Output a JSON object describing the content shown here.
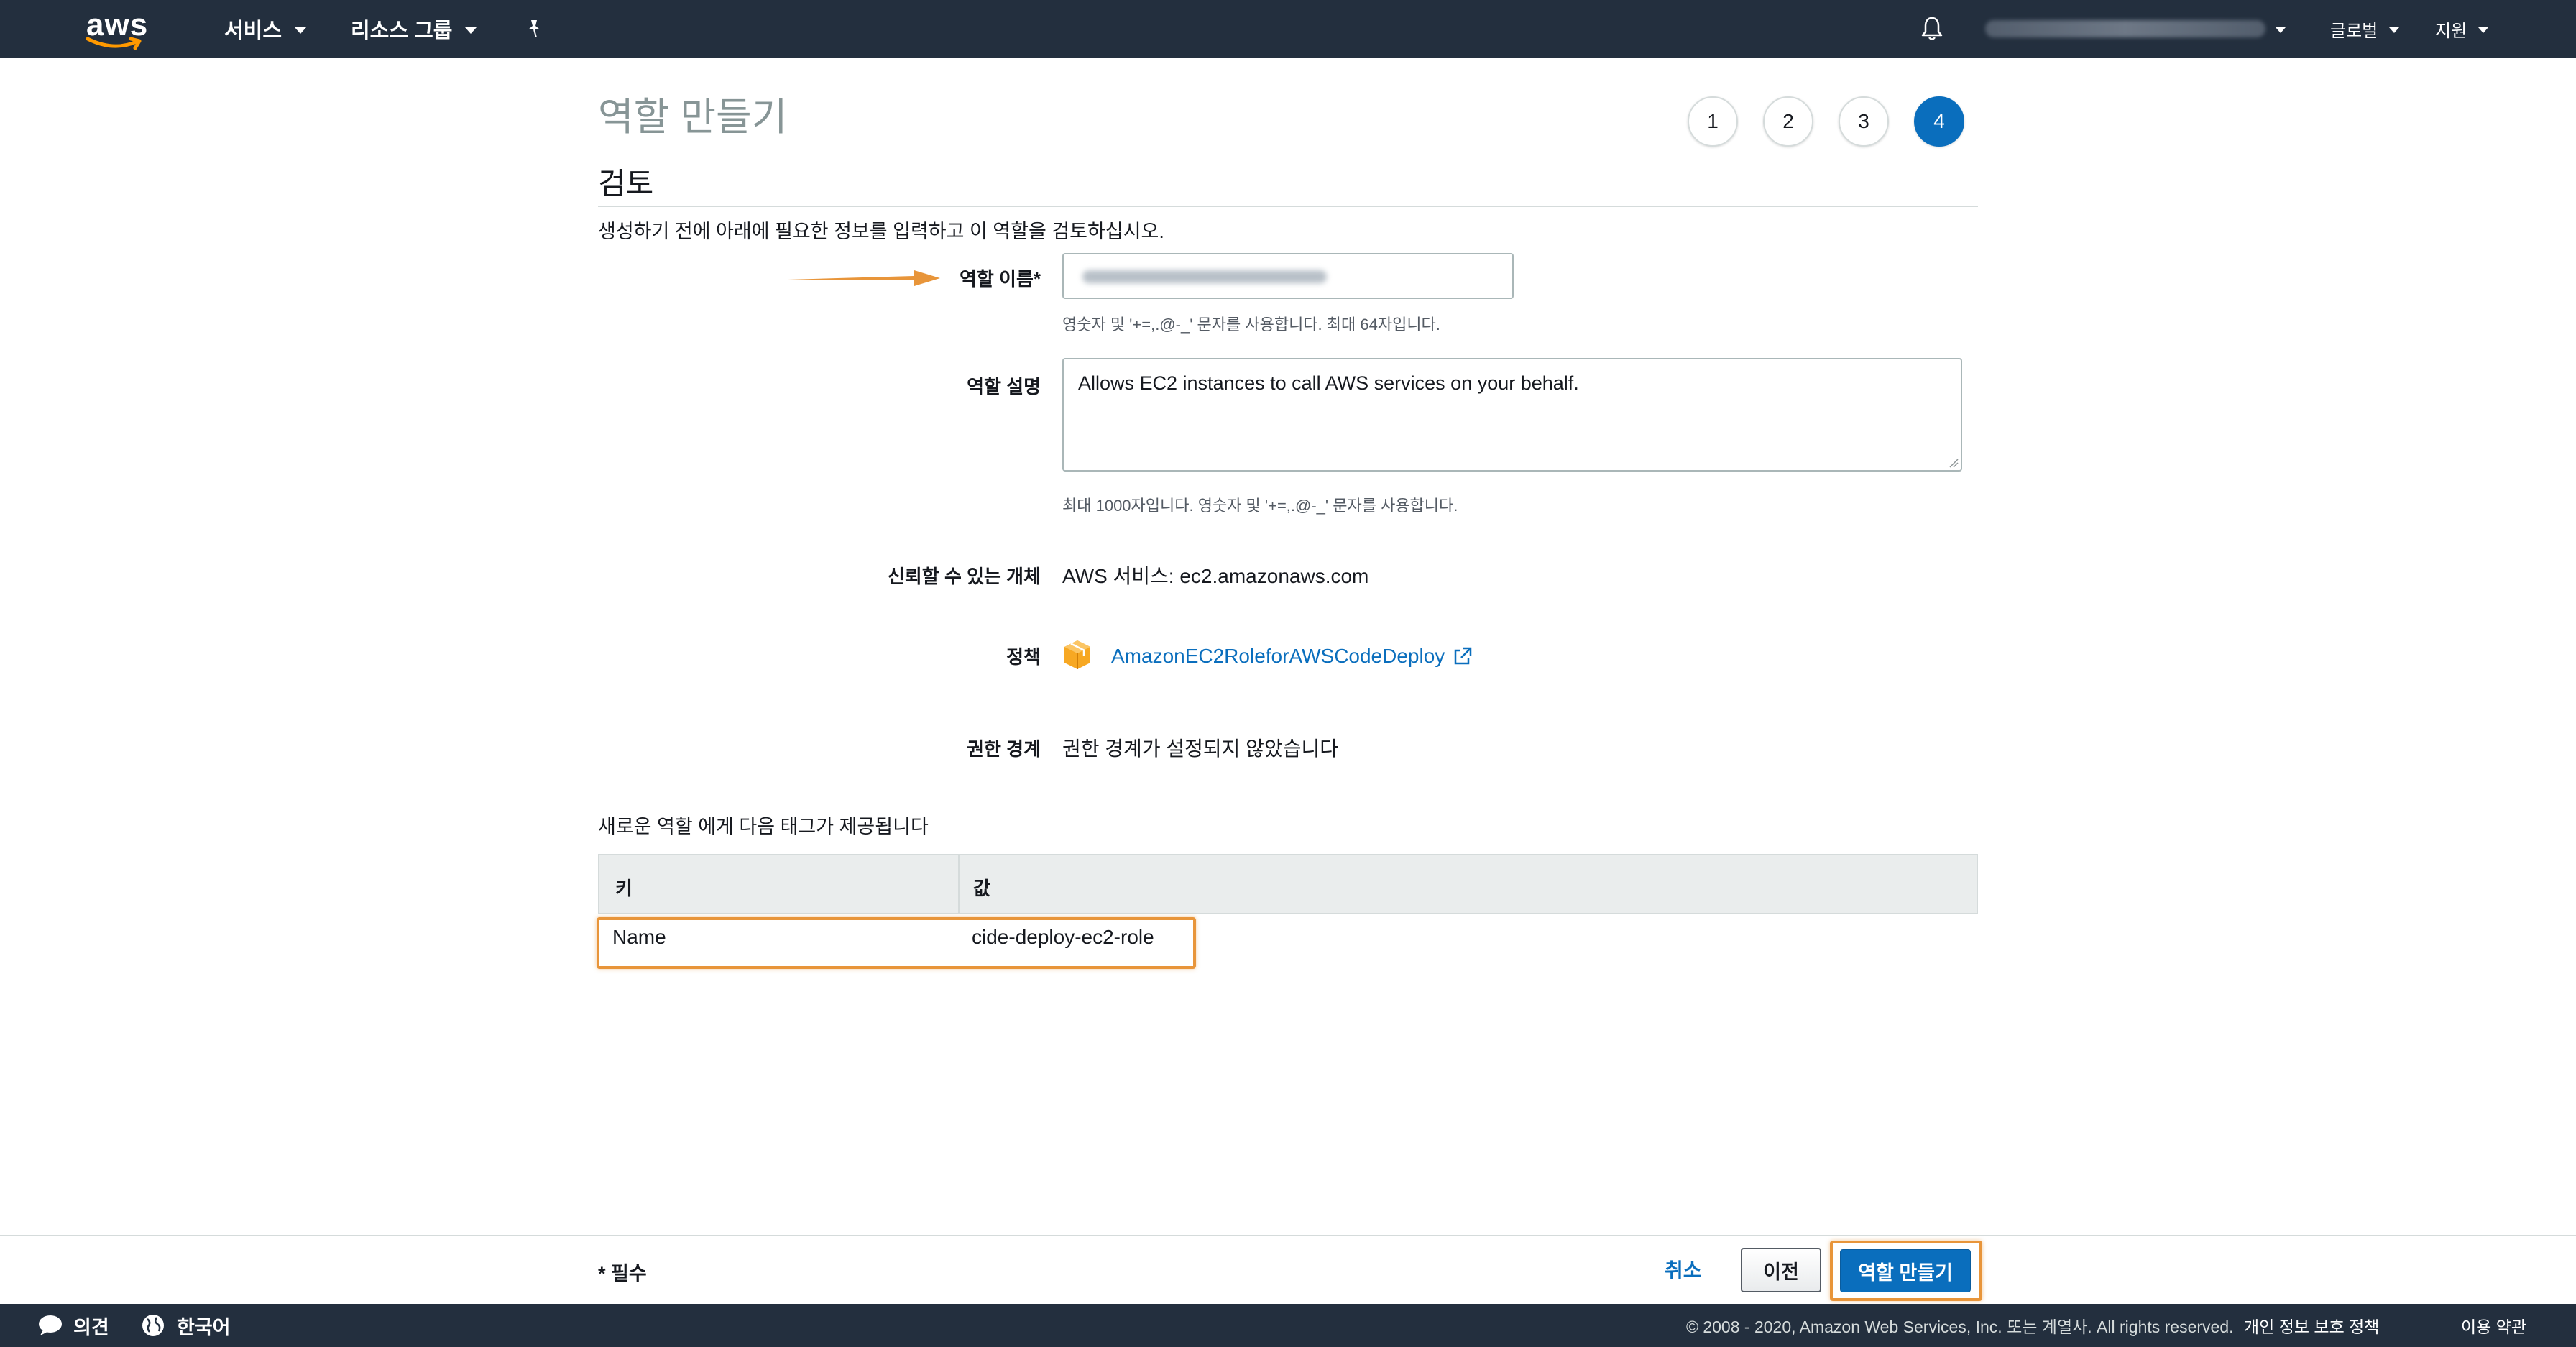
{
  "topnav": {
    "logo_text": "aws",
    "services_label": "서비스",
    "resource_groups_label": "리소스 그룹",
    "pin_icon": "pushpin-icon",
    "bell_icon": "bell-icon",
    "region_label": "글로벌",
    "support_label": "지원"
  },
  "page": {
    "title": "역할 만들기",
    "steps": [
      "1",
      "2",
      "3",
      "4"
    ],
    "active_step": 4,
    "section_title": "검토",
    "intro": "생성하기 전에 아래에 필요한 정보를 입력하고 이 역할을 검토하십시오."
  },
  "form": {
    "role_name_label": "역할 이름*",
    "role_name_hint": "영숫자 및 '+=,.@-_' 문자를 사용합니다. 최대 64자입니다.",
    "role_desc_label": "역할 설명",
    "role_desc_value": "Allows EC2 instances to call AWS services on your behalf.",
    "role_desc_hint": "최대 1000자입니다. 영숫자 및 '+=,.@-_' 문자를 사용합니다.",
    "trusted_label": "신뢰할 수 있는 개체",
    "trusted_value": "AWS 서비스: ec2.amazonaws.com",
    "policy_label": "정책",
    "policy_link": "AmazonEC2RoleforAWSCodeDeploy",
    "boundary_label": "권한 경계",
    "boundary_value": "권한 경계가 설정되지 않았습니다"
  },
  "tags": {
    "intro": "새로운 역할 에게 다음 태그가 제공됩니다",
    "headers": [
      "키",
      "값"
    ],
    "rows": [
      {
        "key": "Name",
        "value": "cide-deploy-ec2-role"
      }
    ]
  },
  "actions": {
    "required_note": "* 필수",
    "cancel": "취소",
    "previous": "이전",
    "create": "역할 만들기"
  },
  "footer": {
    "feedback": "의견",
    "language": "한국어",
    "copyright": "© 2008 - 2020, Amazon Web Services, Inc. 또는 계열사. All rights reserved.",
    "privacy": "개인 정보 보호 정책",
    "terms": "이용 약관"
  },
  "colors": {
    "nav_bg": "#232f3e",
    "accent_blue": "#0a6ebd",
    "highlight_orange": "#e8953a"
  }
}
